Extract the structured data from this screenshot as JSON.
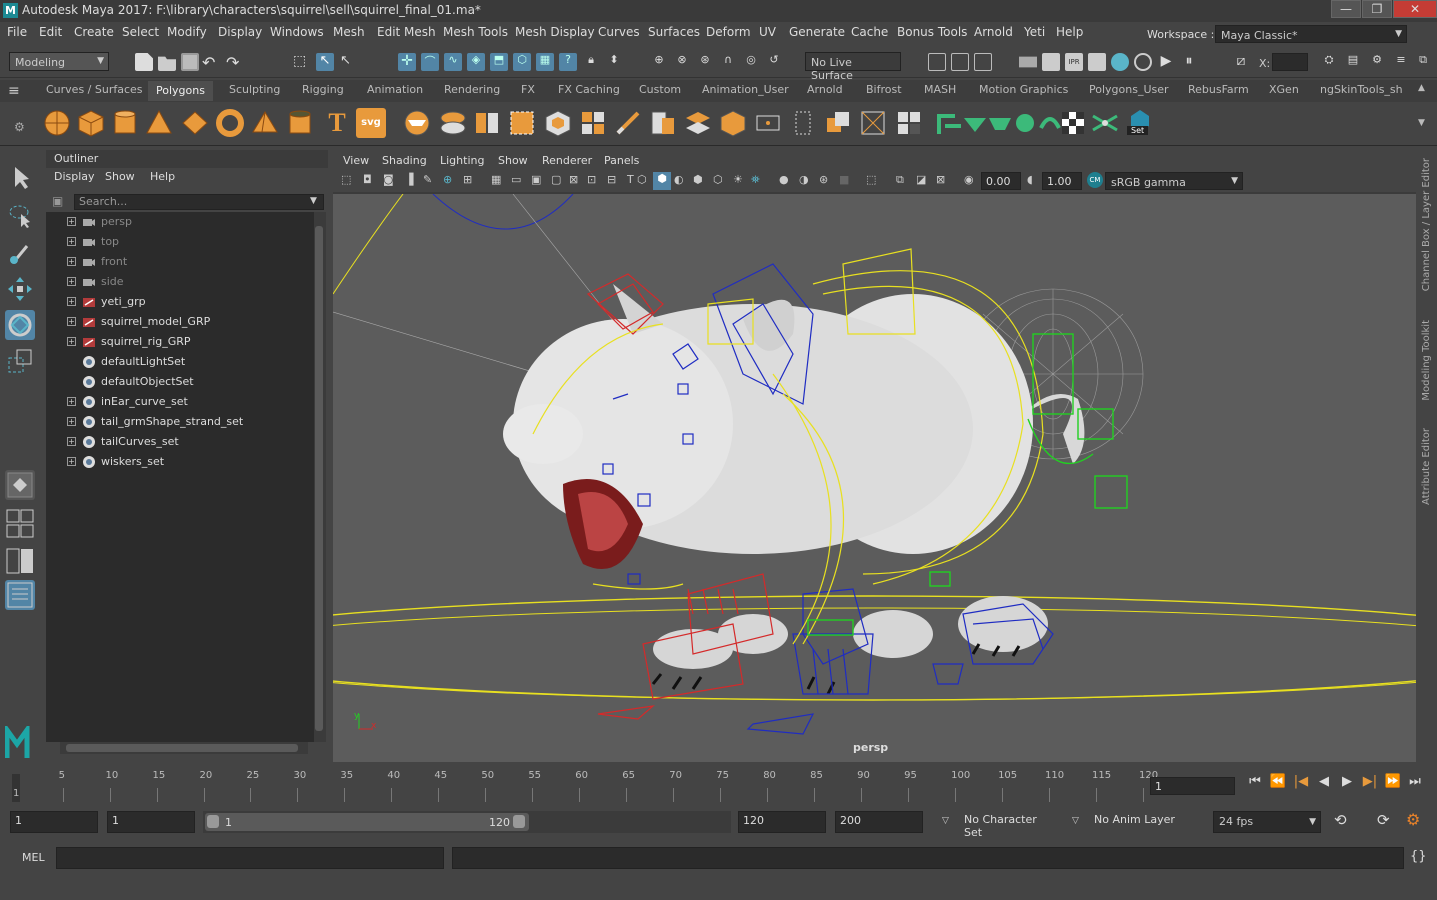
{
  "window": {
    "title": "Autodesk Maya 2017: F:\\library\\characters\\squirrel\\sell\\squirrel_final_01.ma*",
    "logo": "M",
    "min_label": "—",
    "max_label": "❐",
    "close_label": "✕"
  },
  "menubar": {
    "items": [
      "File",
      "Edit",
      "Create",
      "Select",
      "Modify",
      "Display",
      "Windows",
      "Mesh",
      "Edit Mesh",
      "Mesh Tools",
      "Mesh Display",
      "Curves",
      "Surfaces",
      "Deform",
      "UV",
      "Generate",
      "Cache",
      "Bonus Tools",
      "Arnold",
      "Yeti",
      "Help"
    ],
    "workspace_label": "Workspace :",
    "workspace_value": "Maya Classic*"
  },
  "statusline": {
    "mode": "Modeling",
    "live_surface": "No Live Surface",
    "x_label": "X:"
  },
  "shelf": {
    "tabs": [
      "Curves / Surfaces",
      "Polygons",
      "Sculpting",
      "Rigging",
      "Animation",
      "Rendering",
      "FX",
      "FX Caching",
      "Custom",
      "Animation_User",
      "Arnold",
      "Bifrost",
      "MASH",
      "Motion Graphics",
      "Polygons_User",
      "RebusFarm",
      "XGen",
      "ngSkinTools_she"
    ],
    "active_tab": "Polygons",
    "text_icon": "T",
    "svg_icon": "svg",
    "set_label": "Set"
  },
  "outliner": {
    "title": "Outliner",
    "menus": [
      "Display",
      "Show",
      "Help"
    ],
    "search_placeholder": "Search...",
    "items": [
      {
        "label": "persp",
        "type": "camera",
        "dim": true,
        "expand": true
      },
      {
        "label": "top",
        "type": "camera",
        "dim": true,
        "expand": true
      },
      {
        "label": "front",
        "type": "camera",
        "dim": true,
        "expand": true
      },
      {
        "label": "side",
        "type": "camera",
        "dim": true,
        "expand": true
      },
      {
        "label": "yeti_grp",
        "type": "group",
        "dim": false,
        "expand": true
      },
      {
        "label": "squirrel_model_GRP",
        "type": "group",
        "dim": false,
        "expand": true
      },
      {
        "label": "squirrel_rig_GRP",
        "type": "group",
        "dim": false,
        "expand": true
      },
      {
        "label": "defaultLightSet",
        "type": "set",
        "dim": false,
        "expand": false
      },
      {
        "label": "defaultObjectSet",
        "type": "set",
        "dim": false,
        "expand": false
      },
      {
        "label": "inEar_curve_set",
        "type": "set",
        "dim": false,
        "expand": true
      },
      {
        "label": "tail_grmShape_strand_set",
        "type": "set",
        "dim": false,
        "expand": true
      },
      {
        "label": "tailCurves_set",
        "type": "set",
        "dim": false,
        "expand": true
      },
      {
        "label": "wiskers_set",
        "type": "set",
        "dim": false,
        "expand": true
      }
    ]
  },
  "viewport": {
    "menus": [
      "View",
      "Shading",
      "Lighting",
      "Show",
      "Renderer",
      "Panels"
    ],
    "exposure": "0.00",
    "gamma": "1.00",
    "color_space": "sRGB gamma",
    "camera_label": "persp",
    "axis_y": "y",
    "axis_x": "x"
  },
  "right_strip": {
    "tabs": [
      "Channel Box / Layer Editor",
      "Modeling Toolkit",
      "Attribute Editor"
    ]
  },
  "timeslider": {
    "ticks": [
      "5",
      "10",
      "15",
      "20",
      "25",
      "30",
      "35",
      "40",
      "45",
      "50",
      "55",
      "60",
      "65",
      "70",
      "75",
      "80",
      "85",
      "90",
      "95",
      "100",
      "105",
      "110",
      "115",
      "120"
    ],
    "start_tick": "1",
    "current_frame": "1",
    "playback": [
      "⏮",
      "⏪",
      "|◀",
      "◀",
      "▶",
      "▶|",
      "⏩",
      "⏭"
    ]
  },
  "range": {
    "start": "1",
    "playback_start": "1",
    "slider_start": "1",
    "slider_end": "120",
    "playback_end": "120",
    "end": "200",
    "character_set": "No Character Set",
    "anim_layer": "No Anim Layer",
    "fps": "24 fps"
  },
  "cmdline": {
    "label": "MEL"
  },
  "colors": {
    "accent": "#5ab5c9",
    "selection_active": "#5285a6",
    "shelf_orange": "#e89a3c",
    "wire_red": "#d42a2a",
    "wire_blue": "#1f2cc2",
    "wire_yellow": "#e8e020",
    "wire_green": "#22d022"
  }
}
